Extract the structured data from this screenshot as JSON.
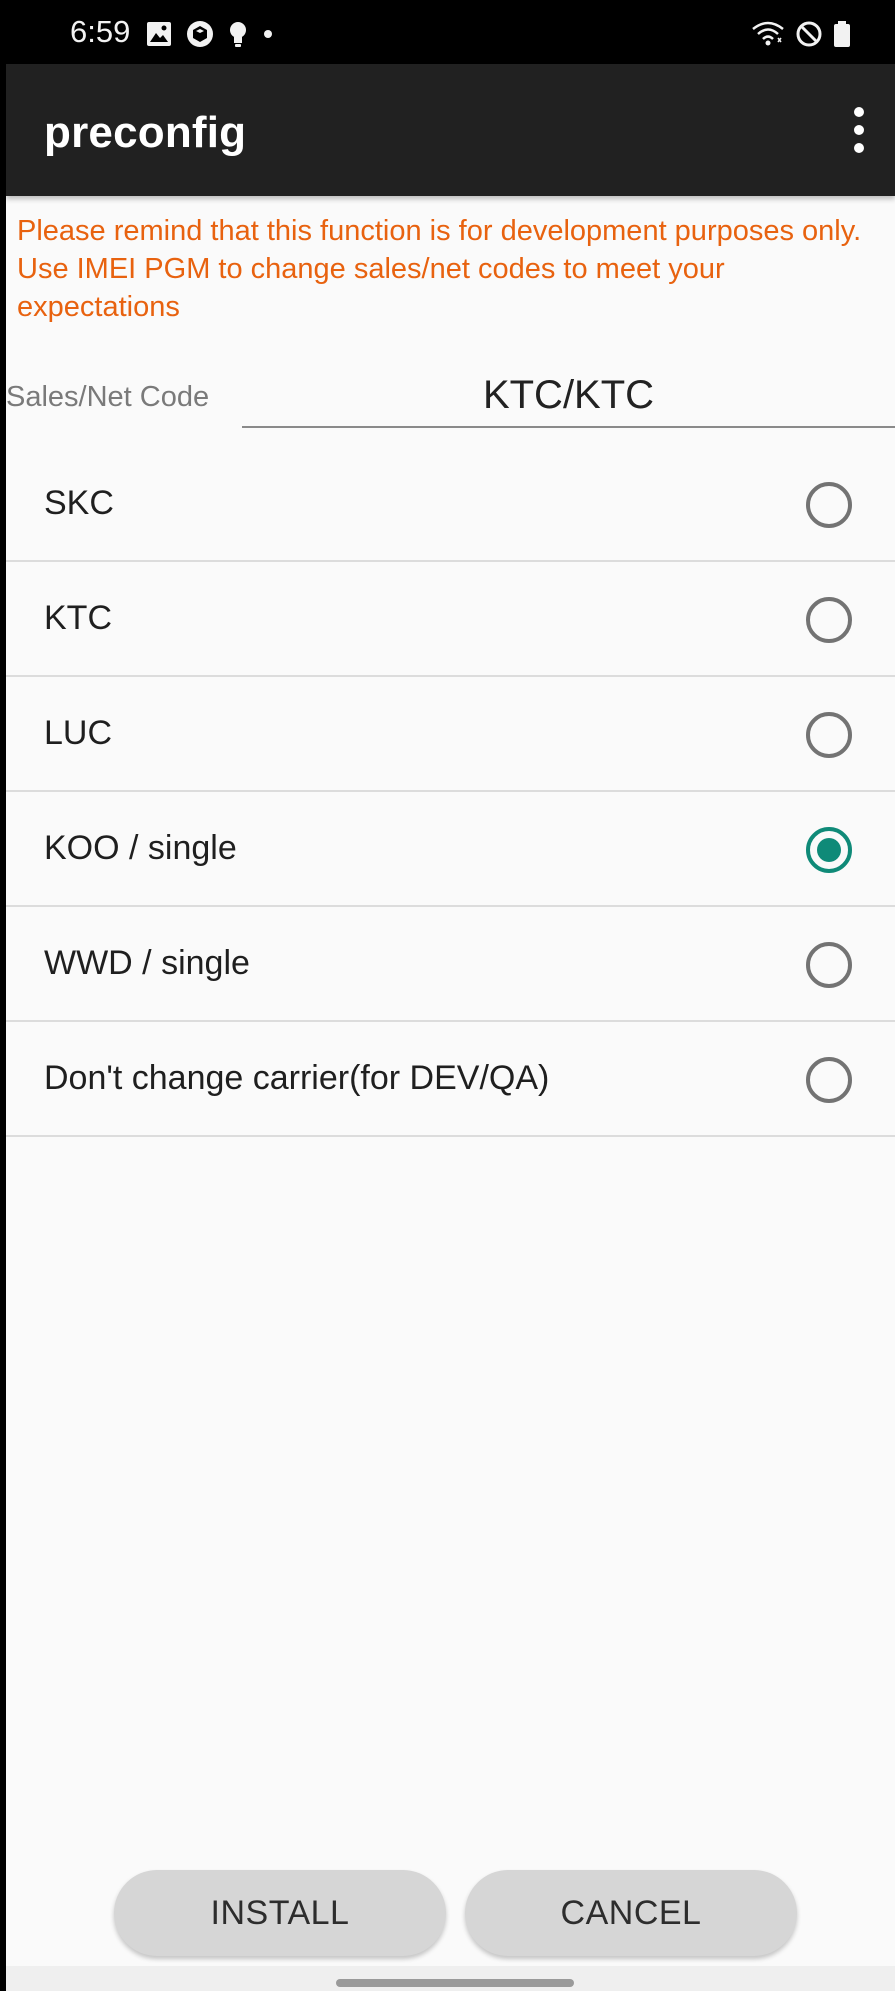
{
  "status_bar": {
    "time": "6:59",
    "left_icons": [
      "image-icon",
      "box-icon",
      "bulb-icon",
      "dot-icon"
    ],
    "right_icons": [
      "wifi-icon",
      "do-not-disturb-icon",
      "battery-icon"
    ]
  },
  "app_bar": {
    "title": "preconfig",
    "menu_icon": "more-vertical-icon"
  },
  "warning": {
    "text": "Please remind that this function is for development purposes only. Use IMEI PGM to change sales/net codes to meet your expectations",
    "color": "#e8620f"
  },
  "code_field": {
    "label": "Sales/Net Code",
    "value": "KTC/KTC"
  },
  "options": [
    {
      "label": "SKC",
      "checked": false
    },
    {
      "label": "KTC",
      "checked": false
    },
    {
      "label": "LUC",
      "checked": false
    },
    {
      "label": "KOO / single",
      "checked": true
    },
    {
      "label": "WWD / single",
      "checked": false
    },
    {
      "label": "Don't change carrier(for DEV/QA)",
      "checked": false
    }
  ],
  "buttons": {
    "install": "INSTALL",
    "cancel": "CANCEL"
  },
  "colors": {
    "accent": "#0f8a78",
    "app_bar": "#212121",
    "warning": "#e8620f"
  }
}
